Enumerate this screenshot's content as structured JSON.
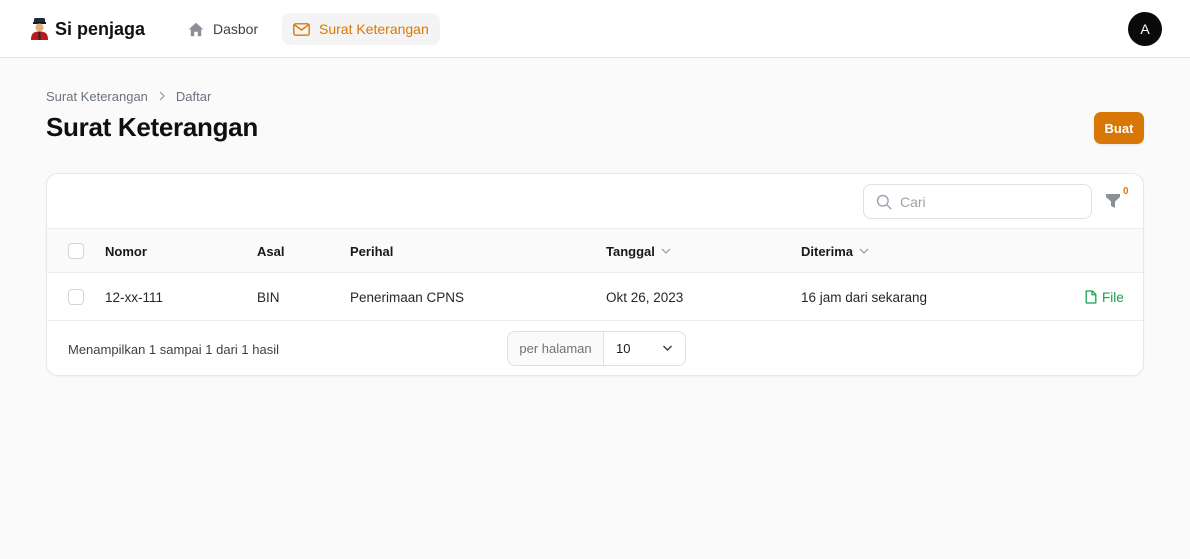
{
  "brand": {
    "name": "Si penjaga"
  },
  "nav": {
    "items": [
      {
        "label": "Dasbor",
        "icon": "home-icon"
      },
      {
        "label": "Surat Keterangan",
        "icon": "envelope-icon",
        "active": true
      }
    ]
  },
  "user": {
    "avatar_initial": "A"
  },
  "breadcrumb": {
    "items": [
      "Surat Keterangan",
      "Daftar"
    ]
  },
  "page": {
    "title": "Surat Keterangan",
    "create_label": "Buat"
  },
  "colors": {
    "accent": "#d97706",
    "file": "#16a34a"
  },
  "search": {
    "placeholder": "Cari",
    "value": ""
  },
  "filter": {
    "active_count": "0"
  },
  "table": {
    "columns": [
      "Nomor",
      "Asal",
      "Perihal",
      "Tanggal",
      "Diterima"
    ],
    "sortable": [
      "Tanggal",
      "Diterima"
    ],
    "rows": [
      {
        "nomor": "12-xx-111",
        "asal": "BIN",
        "perihal": "Penerimaan CPNS",
        "tanggal": "Okt 26, 2023",
        "diterima": "16 jam dari sekarang",
        "action": "File"
      }
    ]
  },
  "pagination": {
    "summary": "Menampilkan 1 sampai 1 dari 1 hasil",
    "per_page_label": "per halaman",
    "per_page_value": "10"
  }
}
